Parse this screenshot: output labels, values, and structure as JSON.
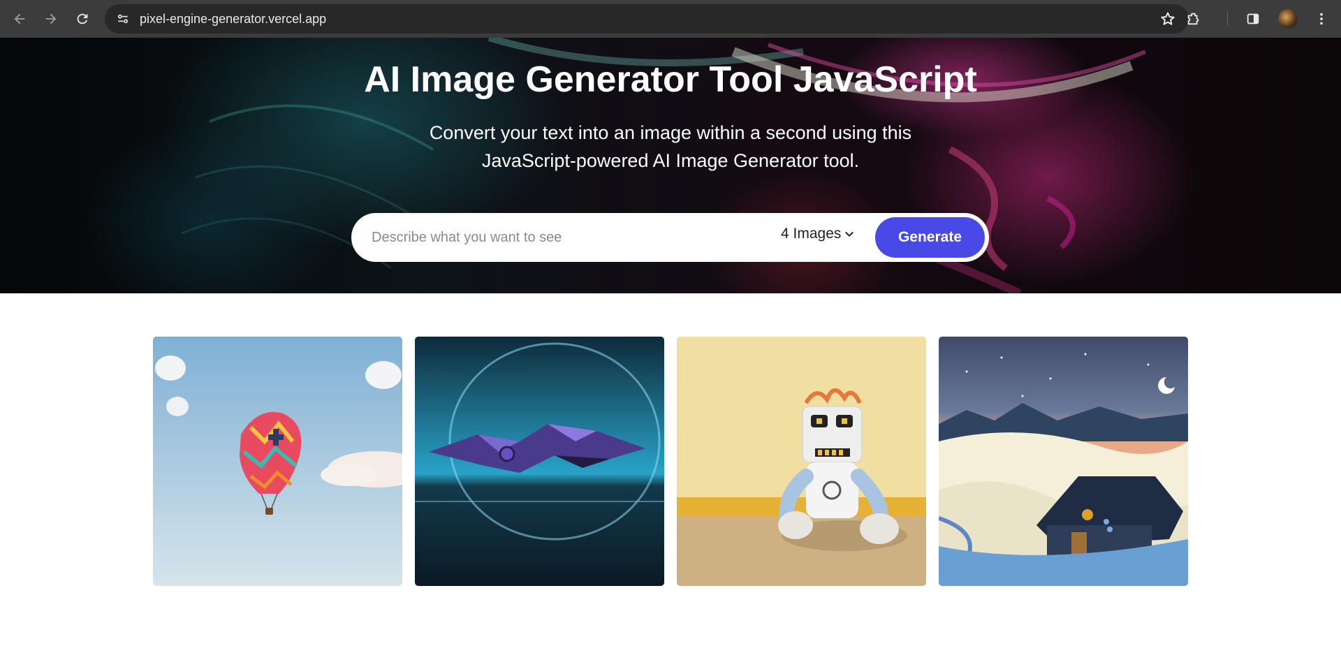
{
  "browser": {
    "url": "pixel-engine-generator.vercel.app",
    "icons": [
      "back-arrow-icon",
      "forward-arrow-icon",
      "reload-icon",
      "site-settings-icon",
      "bookmark-star-icon",
      "extensions-icon",
      "side-panel-icon",
      "profile-avatar",
      "more-menu-icon"
    ]
  },
  "hero": {
    "title": "AI Image Generator Tool JavaScript",
    "subtitle_line1": "Convert your text into an image within a second using this",
    "subtitle_line2": "JavaScript-powered AI Image Generator tool.",
    "search_placeholder": "Describe what you want to see",
    "image_count": "4 Images",
    "generate_label": "Generate",
    "accent_color": "#4949e7"
  },
  "gallery": {
    "images": [
      {
        "subject": "hot-air-balloon"
      },
      {
        "subject": "purple-spaceship"
      },
      {
        "subject": "plush-robot"
      },
      {
        "subject": "snowy-cabin-night"
      }
    ]
  }
}
